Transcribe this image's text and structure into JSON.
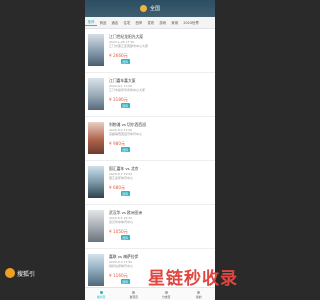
{
  "header": {
    "title": "全国"
  },
  "tabs": [
    "推荐",
    "商品",
    "酒店",
    "住宅",
    "西甲",
    "发布",
    "游戏",
    "家用",
    "2020世界"
  ],
  "cards": [
    {
      "title": "江门世纪龙阳光大厦",
      "date": "2020-1-28 17:30",
      "subtitle": "江门市蓬江区南部市中心大厦",
      "price": "¥ 2660元",
      "tag": "国际"
    },
    {
      "title": "江门嘉年嘉大厦",
      "date": "2020-6-1 17:00",
      "subtitle": "江门市嘉年华商务中心大厦",
      "price": "¥ 3180元",
      "tag": "国际"
    },
    {
      "title": "利物浦 vs 切尔西西班",
      "date": "2020-8-4 17:00",
      "subtitle": "英超联赛西班牙体育中心",
      "price": "¥ 980元",
      "tag": "国际"
    },
    {
      "title": "国汇嘉年 vs 北京",
      "date": "2020-8-7 19:00",
      "subtitle": "国汇嘉年体育中心",
      "price": "¥ 680元",
      "tag": "国际"
    },
    {
      "title": "武汉华 vs 欧洲亚洲",
      "date": "2020-8-6 19:30",
      "subtitle": "武汉华中体育中心",
      "price": "¥ 1050元",
      "tag": "国际"
    },
    {
      "title": "嘉联 vs 梅萨拉伊",
      "date": "2020-8-9 17:00",
      "subtitle": "梅萨拉伊体育中心",
      "price": "¥ 1160元",
      "tag": "国际"
    }
  ],
  "bottom_nav": [
    "推荐页",
    "发现页",
    "分类页",
    "我的"
  ],
  "brand": {
    "name": "搜狐引"
  },
  "watermark": "星链秒收录",
  "colors": {
    "accent": "#2bb5c7",
    "price": "#e35b3b",
    "header": "#2c4e63"
  }
}
